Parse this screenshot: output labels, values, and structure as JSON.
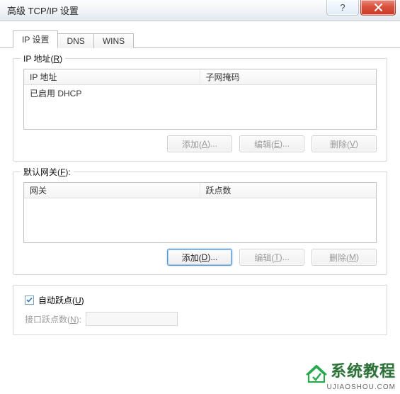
{
  "window": {
    "title": "高级 TCP/IP 设置"
  },
  "tabs": {
    "ip": "IP 设置",
    "dns": "DNS",
    "wins": "WINS"
  },
  "ipGroup": {
    "legend_prefix": "IP 地址(",
    "legend_key": "R",
    "legend_suffix": ")",
    "col_ip": "IP 地址",
    "col_mask": "子网掩码",
    "row0": "已启用 DHCP",
    "btn_add_prefix": "添加(",
    "btn_add_key": "A",
    "btn_add_suffix": ")...",
    "btn_edit_prefix": "编辑(",
    "btn_edit_key": "E",
    "btn_edit_suffix": ")...",
    "btn_del_prefix": "删除(",
    "btn_del_key": "V",
    "btn_del_suffix": ")"
  },
  "gwGroup": {
    "legend_prefix": "默认网关(",
    "legend_key": "F",
    "legend_suffix": "):",
    "col_gw": "网关",
    "col_metric": "跃点数",
    "btn_add_prefix": "添加(",
    "btn_add_key": "D",
    "btn_add_suffix": ")...",
    "btn_edit_prefix": "编辑(",
    "btn_edit_key": "T",
    "btn_edit_suffix": ")...",
    "btn_del_prefix": "删除(",
    "btn_del_key": "M",
    "btn_del_suffix": ")"
  },
  "auto": {
    "chk_prefix": "自动跃点(",
    "chk_key": "U",
    "chk_suffix": ")",
    "label_prefix": "接口跃点数(",
    "label_key": "N",
    "label_suffix": "):",
    "checked": true
  },
  "watermark": {
    "cn": "系统教程",
    "url": "UJIAOSHOU.COM"
  }
}
